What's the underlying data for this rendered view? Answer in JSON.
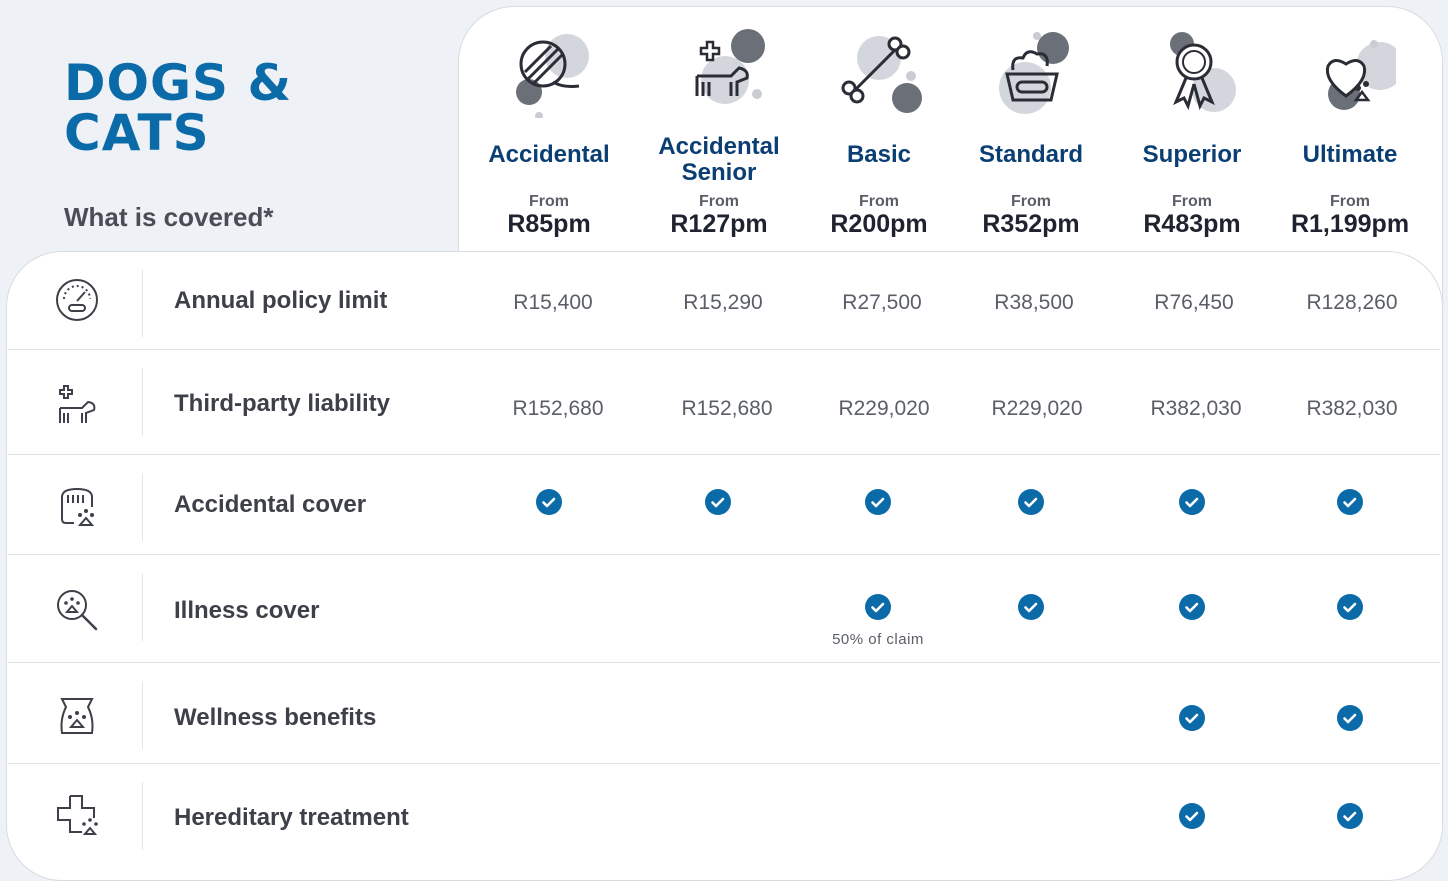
{
  "brand": {
    "title_line1": "DOGS &",
    "title_line2": "CATS"
  },
  "covered_heading": "What is covered*",
  "plans": [
    {
      "name": "Accidental",
      "from": "From",
      "price": "R85pm",
      "icon": "ball-icon"
    },
    {
      "name": "Accidental Senior",
      "from": "From",
      "price": "R127pm",
      "icon": "senior-dog-icon"
    },
    {
      "name": "Basic",
      "from": "From",
      "price": "R200pm",
      "icon": "bone-icon"
    },
    {
      "name": "Standard",
      "from": "From",
      "price": "R352pm",
      "icon": "food-bowl-icon"
    },
    {
      "name": "Superior",
      "from": "From",
      "price": "R483pm",
      "icon": "award-ribbon-icon"
    },
    {
      "name": "Ultimate",
      "from": "From",
      "price": "R1,199pm",
      "icon": "heart-paw-icon"
    }
  ],
  "rows": [
    {
      "label": "Annual policy limit",
      "icon": "speedometer-icon",
      "values": [
        "R15,400",
        "R15,290",
        "R27,500",
        "R38,500",
        "R76,450",
        "R128,260"
      ]
    },
    {
      "label": "Third-party liability",
      "icon": "dog-plus-icon",
      "values": [
        "R152,680",
        "R152,680",
        "R229,020",
        "R229,020",
        "R382,030",
        "R382,030"
      ]
    },
    {
      "label": "Accidental cover",
      "icon": "pet-carrier-icon",
      "checks": [
        true,
        true,
        true,
        true,
        true,
        true
      ]
    },
    {
      "label": "Illness cover",
      "icon": "magnifier-paw-icon",
      "checks": [
        false,
        false,
        true,
        true,
        true,
        true
      ],
      "note": "50% of claim"
    },
    {
      "label": "Wellness benefits",
      "icon": "food-bag-icon",
      "checks": [
        false,
        false,
        false,
        false,
        true,
        true
      ]
    },
    {
      "label": "Hereditary treatment",
      "icon": "medical-cross-paw-icon",
      "checks": [
        false,
        false,
        false,
        false,
        true,
        true
      ]
    }
  ],
  "colors": {
    "brand_blue": "#0b6aa8",
    "check_blue": "#0b6aa8",
    "heading_navy": "#0b3f73"
  }
}
